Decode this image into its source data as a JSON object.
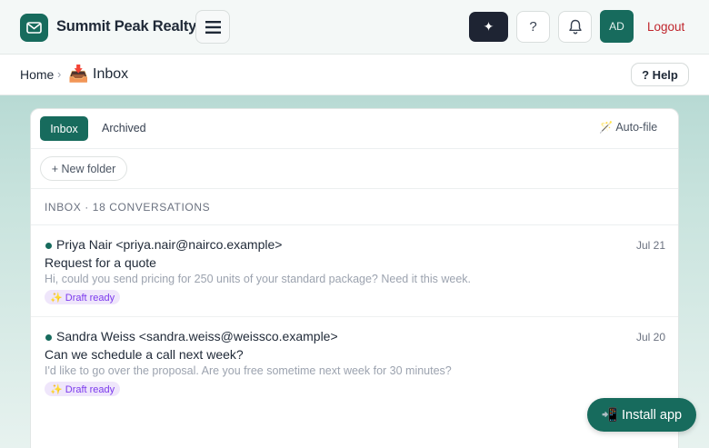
{
  "header": {
    "brand": "Summit Peak Realty",
    "logo_icon": "mail-icon",
    "sparkle_label": "✦",
    "help_label": "?",
    "avatar_initials": "AD",
    "logout_label": "Logout"
  },
  "breadcrumb": {
    "home": "Home",
    "separator": "›",
    "current_icon": "📥",
    "current": "Inbox",
    "help_button": "? Help"
  },
  "tabs": {
    "inbox": "Inbox",
    "archived": "Archived",
    "autofile": "🪄 Auto-file"
  },
  "folders": {
    "new_folder": "+ New folder"
  },
  "list": {
    "header": "INBOX · 18 CONVERSATIONS",
    "conversations": [
      {
        "from": "Priya Nair <priya.nair@nairco.example>",
        "date": "Jul 21",
        "subject": "Request for a quote",
        "preview": "Hi, could you send pricing for 250 units of your standard package? Need it this week.",
        "badge": "✨ Draft ready",
        "unread": true
      },
      {
        "from": "Sandra Weiss <sandra.weiss@weissco.example>",
        "date": "Jul 20",
        "subject": "Can we schedule a call next week?",
        "preview": "I'd like to go over the proposal. Are you free sometime next week for 30 minutes?",
        "badge": "✨ Draft ready",
        "unread": true
      }
    ]
  },
  "install_button": "📲 Install app",
  "colors": {
    "accent": "#176b5d",
    "dark_button": "#1e2433",
    "logout": "#c0262d",
    "badge_bg": "#efe6fb",
    "badge_text": "#7c3aed"
  }
}
